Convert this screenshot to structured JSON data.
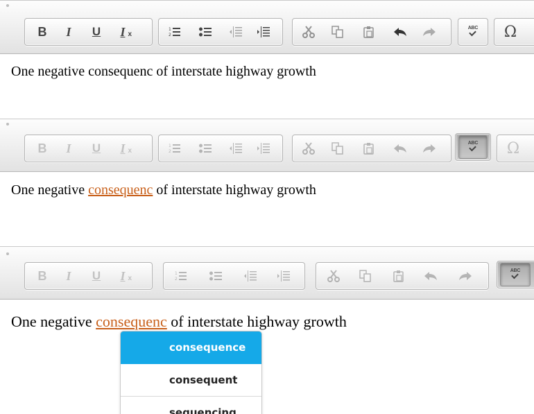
{
  "toolbar": {
    "buttons": {
      "bold": "B",
      "italic": "I",
      "underline": "U",
      "remove_format": "I",
      "remove_format_sub": "x",
      "spellcheck": "ABC",
      "special_char": "Ω"
    },
    "icons": [
      "numbered-list-icon",
      "bulleted-list-icon",
      "decrease-indent-icon",
      "increase-indent-icon",
      "cut-icon",
      "copy-icon",
      "paste-icon",
      "undo-icon",
      "redo-icon"
    ]
  },
  "editor": {
    "before": "One negative ",
    "misspelled": "consequenc",
    "after": " of interstate highway growth"
  },
  "spell_suggestions": {
    "items": [
      "consequence",
      "consequent",
      "sequencing"
    ],
    "selected": "consequence"
  },
  "colors": {
    "misspelled_underline": "#c85f19",
    "suggestion_highlight": "#15a9e8"
  }
}
